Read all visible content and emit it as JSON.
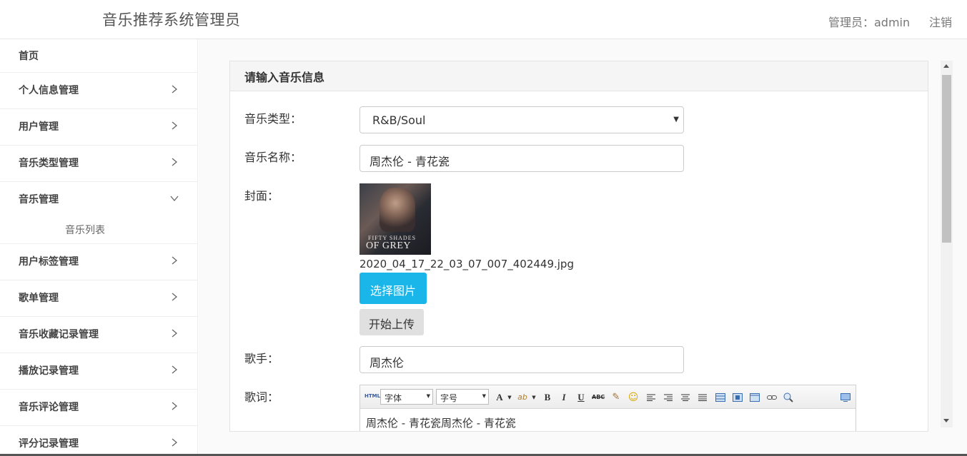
{
  "header": {
    "app_title": "音乐推荐系统管理员",
    "admin_label": "管理员：admin",
    "logout": "注销"
  },
  "sidebar": {
    "items": [
      {
        "label": "首页",
        "chevron": "none"
      },
      {
        "label": "个人信息管理",
        "chevron": "right"
      },
      {
        "label": "用户管理",
        "chevron": "right"
      },
      {
        "label": "音乐类型管理",
        "chevron": "right"
      },
      {
        "label": "音乐管理",
        "chevron": "down",
        "children": [
          {
            "label": "音乐列表"
          }
        ]
      },
      {
        "label": "用户标签管理",
        "chevron": "right"
      },
      {
        "label": "歌单管理",
        "chevron": "right"
      },
      {
        "label": "音乐收藏记录管理",
        "chevron": "right"
      },
      {
        "label": "播放记录管理",
        "chevron": "right"
      },
      {
        "label": "音乐评论管理",
        "chevron": "right"
      },
      {
        "label": "评分记录管理",
        "chevron": "right"
      }
    ]
  },
  "form": {
    "heading": "请输入音乐信息",
    "type_label": "音乐类型：",
    "type_value": "R&B/Soul",
    "name_label": "音乐名称：",
    "name_value": "周杰伦 - 青花瓷",
    "cover_label": "封面：",
    "cover_text_line1": "FIFTY SHADES",
    "cover_text_line2": "OF GREY",
    "cover_filename": "2020_04_17_22_03_07_007_402449.jpg",
    "choose_button": "选择图片",
    "upload_button": "开始上传",
    "singer_label": "歌手：",
    "singer_value": "周杰伦",
    "lyrics_label": "歌词：",
    "lyrics_value": "周杰伦 - 青花瓷周杰伦 - 青花瓷"
  },
  "editor_toolbar": {
    "html_label": "HTML",
    "font_family": "字体",
    "font_size": "字号",
    "font_color_glyph": "A",
    "bold_glyph": "B",
    "italic_glyph": "I",
    "underline_glyph": "U",
    "strike_glyph": "ABC"
  },
  "colors": {
    "accent": "#1ab6ea",
    "panel_heading_bg": "#f5f5f5",
    "content_bg": "#fafafa"
  }
}
